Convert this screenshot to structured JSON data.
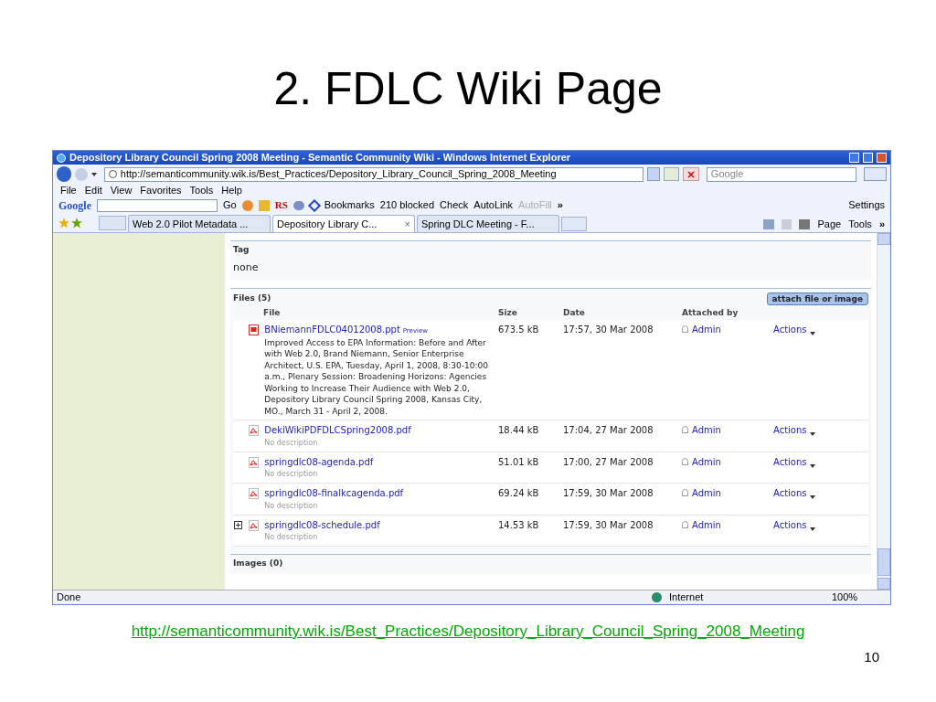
{
  "slide": {
    "title": "2. FDLC Wiki Page",
    "link": "http://semanticommunity.wik.is/Best_Practices/Depository_Library_Council_Spring_2008_Meeting",
    "page_number": "10"
  },
  "browser": {
    "title": "Depository Library Council Spring 2008 Meeting - Semantic Community Wiki - Windows Internet Explorer",
    "address": "http://semanticommunity.wik.is/Best_Practices/Depository_Library_Council_Spring_2008_Meeting",
    "search_placeholder": "Google",
    "menu": [
      "File",
      "Edit",
      "View",
      "Favorites",
      "Tools",
      "Help"
    ],
    "google_toolbar": {
      "logo": "Google",
      "go": "Go",
      "rs": "RS",
      "bookmarks": "Bookmarks",
      "blocked": "210 blocked",
      "check": "Check",
      "autolink": "AutoLink",
      "autofill": "AutoFill",
      "more": "»",
      "settings": "Settings"
    },
    "tabs": [
      {
        "label": "Web 2.0 Pilot Metadata ...",
        "selected": false
      },
      {
        "label": "Depository Library C...",
        "selected": true
      },
      {
        "label": "Spring DLC Meeting - F...",
        "selected": false
      }
    ],
    "close_tab": "×",
    "commands": {
      "page": "Page",
      "tools": "Tools",
      "more": "»"
    },
    "status": {
      "text": "Done",
      "zone": "Internet",
      "zoom": "100%"
    }
  },
  "page": {
    "tag_heading": "Tag",
    "tag_value": "none",
    "files_heading": "Files (5)",
    "attach_button": "attach file or image",
    "columns": [
      "File",
      "Size",
      "Date",
      "Attached by"
    ],
    "files": [
      {
        "kind": "ppt",
        "name": "BNiemannFDLC04012008.ppt",
        "preview": "Preview",
        "description": "Improved Access to EPA Information: Before and After with Web 2.0, Brand Niemann, Senior Enterprise Architect, U.S. EPA, Tuesday, April 1, 2008, 8:30-10:00 a.m., Plenary Session: Broadening Horizons: Agencies Working to Increase Their Audience with Web 2.0, Depository Library Council Spring 2008, Kansas City, MO., March 31 - April 2, 2008.",
        "description_missing": false,
        "expandable": false,
        "size": "673.5 kB",
        "date": "17:57, 30 Mar 2008",
        "author": "Admin",
        "actions": "Actions"
      },
      {
        "kind": "pdf",
        "name": "DekiWikiPDFDLCSpring2008.pdf",
        "description": "No description",
        "description_missing": true,
        "expandable": false,
        "size": "18.44 kB",
        "date": "17:04, 27 Mar 2008",
        "author": "Admin",
        "actions": "Actions"
      },
      {
        "kind": "pdf",
        "name": "springdlc08-agenda.pdf",
        "description": "No description",
        "description_missing": true,
        "expandable": false,
        "size": "51.01 kB",
        "date": "17:00, 27 Mar 2008",
        "author": "Admin",
        "actions": "Actions"
      },
      {
        "kind": "pdf",
        "name": "springdlc08-finalkcagenda.pdf",
        "description": "No description",
        "description_missing": true,
        "expandable": false,
        "size": "69.24 kB",
        "date": "17:59, 30 Mar 2008",
        "author": "Admin",
        "actions": "Actions"
      },
      {
        "kind": "pdf",
        "name": "springdlc08-schedule.pdf",
        "description": "No description",
        "description_missing": true,
        "expandable": true,
        "size": "14.53 kB",
        "date": "17:59, 30 Mar 2008",
        "author": "Admin",
        "actions": "Actions"
      }
    ],
    "images_heading": "Images (0)"
  }
}
